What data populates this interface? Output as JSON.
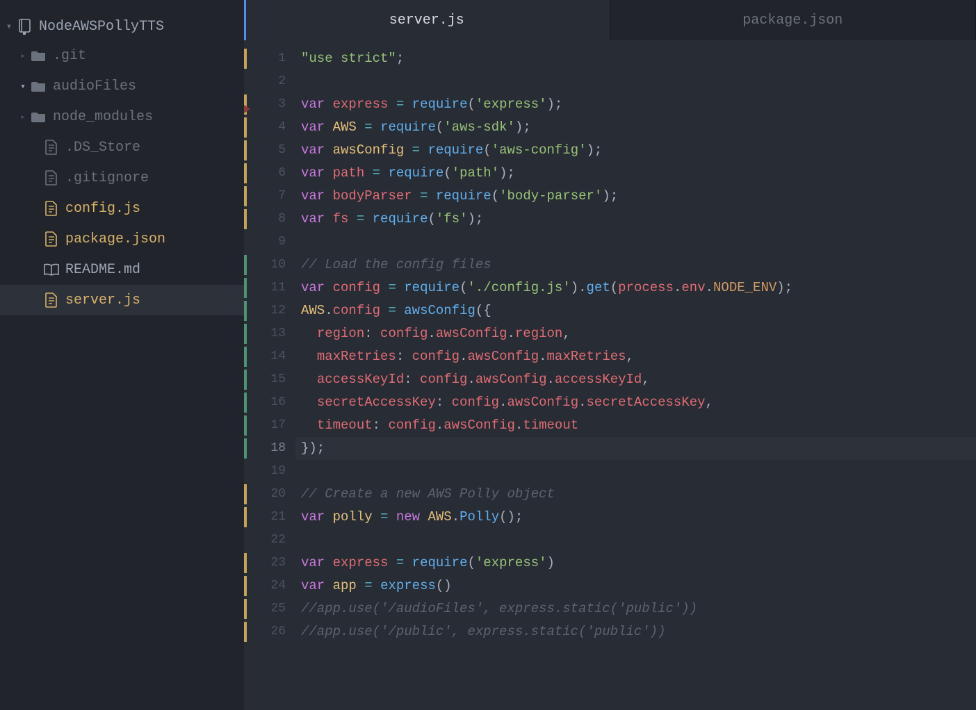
{
  "project": {
    "name": "NodeAWSPollyTTS"
  },
  "tree": [
    {
      "kind": "folder",
      "name": ".git",
      "open": false,
      "modified": false
    },
    {
      "kind": "folder",
      "name": "audioFiles",
      "open": true,
      "modified": false
    },
    {
      "kind": "folder",
      "name": "node_modules",
      "open": false,
      "modified": false
    },
    {
      "kind": "file",
      "name": ".DS_Store",
      "icon": "file",
      "modified": false,
      "indent": true
    },
    {
      "kind": "file",
      "name": ".gitignore",
      "icon": "file",
      "modified": false,
      "indent": true
    },
    {
      "kind": "file",
      "name": "config.js",
      "icon": "file",
      "modified": true,
      "indent": true
    },
    {
      "kind": "file",
      "name": "package.json",
      "icon": "file",
      "modified": true,
      "indent": true
    },
    {
      "kind": "file",
      "name": "README.md",
      "icon": "book",
      "modified": false,
      "indent": true,
      "light": true
    },
    {
      "kind": "file",
      "name": "server.js",
      "icon": "file",
      "modified": true,
      "indent": true,
      "selected": true
    }
  ],
  "tabs": [
    {
      "label": "server.js",
      "active": true
    },
    {
      "label": "package.json",
      "active": false
    }
  ],
  "gutterMarks": {
    "yellow": [
      1,
      3,
      4,
      5,
      6,
      7,
      8,
      20,
      21,
      23,
      24,
      25,
      26
    ],
    "green": [
      10,
      11,
      12,
      13,
      14,
      15,
      16,
      17,
      18
    ]
  },
  "currentLine": 18,
  "code": [
    {
      "n": 1,
      "t": [
        [
          "str",
          "\"use strict\""
        ],
        [
          "pun",
          ";"
        ]
      ]
    },
    {
      "n": 2,
      "t": []
    },
    {
      "n": 3,
      "t": [
        [
          "kw",
          "var"
        ],
        [
          "pun",
          " "
        ],
        [
          "nm2",
          "express"
        ],
        [
          "pun",
          " "
        ],
        [
          "op",
          "="
        ],
        [
          "pun",
          " "
        ],
        [
          "fn",
          "require"
        ],
        [
          "pun",
          "("
        ],
        [
          "str",
          "'express'"
        ],
        [
          "pun",
          ");"
        ]
      ]
    },
    {
      "n": 4,
      "t": [
        [
          "kw",
          "var"
        ],
        [
          "pun",
          " "
        ],
        [
          "nm1",
          "AWS"
        ],
        [
          "pun",
          " "
        ],
        [
          "op",
          "="
        ],
        [
          "pun",
          " "
        ],
        [
          "fn",
          "require"
        ],
        [
          "pun",
          "("
        ],
        [
          "str",
          "'aws-sdk'"
        ],
        [
          "pun",
          ");"
        ]
      ]
    },
    {
      "n": 5,
      "t": [
        [
          "kw",
          "var"
        ],
        [
          "pun",
          " "
        ],
        [
          "nm1",
          "awsConfig"
        ],
        [
          "pun",
          " "
        ],
        [
          "op",
          "="
        ],
        [
          "pun",
          " "
        ],
        [
          "fn",
          "require"
        ],
        [
          "pun",
          "("
        ],
        [
          "str",
          "'aws-config'"
        ],
        [
          "pun",
          ");"
        ]
      ]
    },
    {
      "n": 6,
      "t": [
        [
          "kw",
          "var"
        ],
        [
          "pun",
          " "
        ],
        [
          "nm2",
          "path"
        ],
        [
          "pun",
          " "
        ],
        [
          "op",
          "="
        ],
        [
          "pun",
          " "
        ],
        [
          "fn",
          "require"
        ],
        [
          "pun",
          "("
        ],
        [
          "str",
          "'path'"
        ],
        [
          "pun",
          ");"
        ]
      ]
    },
    {
      "n": 7,
      "t": [
        [
          "kw",
          "var"
        ],
        [
          "pun",
          " "
        ],
        [
          "nm2",
          "bodyParser"
        ],
        [
          "pun",
          " "
        ],
        [
          "op",
          "="
        ],
        [
          "pun",
          " "
        ],
        [
          "fn",
          "require"
        ],
        [
          "pun",
          "("
        ],
        [
          "str",
          "'body-parser'"
        ],
        [
          "pun",
          ");"
        ]
      ]
    },
    {
      "n": 8,
      "t": [
        [
          "kw",
          "var"
        ],
        [
          "pun",
          " "
        ],
        [
          "nm2",
          "fs"
        ],
        [
          "pun",
          " "
        ],
        [
          "op",
          "="
        ],
        [
          "pun",
          " "
        ],
        [
          "fn",
          "require"
        ],
        [
          "pun",
          "("
        ],
        [
          "str",
          "'fs'"
        ],
        [
          "pun",
          ");"
        ]
      ]
    },
    {
      "n": 9,
      "t": []
    },
    {
      "n": 10,
      "t": [
        [
          "cmt",
          "// Load the config files"
        ]
      ]
    },
    {
      "n": 11,
      "t": [
        [
          "kw",
          "var"
        ],
        [
          "pun",
          " "
        ],
        [
          "nm2",
          "config"
        ],
        [
          "pun",
          " "
        ],
        [
          "op",
          "="
        ],
        [
          "pun",
          " "
        ],
        [
          "fn",
          "require"
        ],
        [
          "pun",
          "("
        ],
        [
          "str",
          "'./config.js'"
        ],
        [
          "pun",
          ")."
        ],
        [
          "fn",
          "get"
        ],
        [
          "pun",
          "("
        ],
        [
          "nm2",
          "process"
        ],
        [
          "pun",
          "."
        ],
        [
          "nm2",
          "env"
        ],
        [
          "pun",
          "."
        ],
        [
          "cst",
          "NODE_ENV"
        ],
        [
          "pun",
          ");"
        ]
      ]
    },
    {
      "n": 12,
      "t": [
        [
          "nm1",
          "AWS"
        ],
        [
          "pun",
          "."
        ],
        [
          "nm2",
          "config"
        ],
        [
          "pun",
          " "
        ],
        [
          "op",
          "="
        ],
        [
          "pun",
          " "
        ],
        [
          "fn",
          "awsConfig"
        ],
        [
          "pun",
          "({"
        ]
      ]
    },
    {
      "n": 13,
      "t": [
        [
          "pun",
          "  "
        ],
        [
          "nm2",
          "region"
        ],
        [
          "pun",
          ": "
        ],
        [
          "nm2",
          "config"
        ],
        [
          "pun",
          "."
        ],
        [
          "nm2",
          "awsConfig"
        ],
        [
          "pun",
          "."
        ],
        [
          "nm2",
          "region"
        ],
        [
          "pun",
          ","
        ]
      ]
    },
    {
      "n": 14,
      "t": [
        [
          "pun",
          "  "
        ],
        [
          "nm2",
          "maxRetries"
        ],
        [
          "pun",
          ": "
        ],
        [
          "nm2",
          "config"
        ],
        [
          "pun",
          "."
        ],
        [
          "nm2",
          "awsConfig"
        ],
        [
          "pun",
          "."
        ],
        [
          "nm2",
          "maxRetries"
        ],
        [
          "pun",
          ","
        ]
      ]
    },
    {
      "n": 15,
      "t": [
        [
          "pun",
          "  "
        ],
        [
          "nm2",
          "accessKeyId"
        ],
        [
          "pun",
          ": "
        ],
        [
          "nm2",
          "config"
        ],
        [
          "pun",
          "."
        ],
        [
          "nm2",
          "awsConfig"
        ],
        [
          "pun",
          "."
        ],
        [
          "nm2",
          "accessKeyId"
        ],
        [
          "pun",
          ","
        ]
      ]
    },
    {
      "n": 16,
      "t": [
        [
          "pun",
          "  "
        ],
        [
          "nm2",
          "secretAccessKey"
        ],
        [
          "pun",
          ": "
        ],
        [
          "nm2",
          "config"
        ],
        [
          "pun",
          "."
        ],
        [
          "nm2",
          "awsConfig"
        ],
        [
          "pun",
          "."
        ],
        [
          "nm2",
          "secretAccessKey"
        ],
        [
          "pun",
          ","
        ]
      ]
    },
    {
      "n": 17,
      "t": [
        [
          "pun",
          "  "
        ],
        [
          "nm2",
          "timeout"
        ],
        [
          "pun",
          ": "
        ],
        [
          "nm2",
          "config"
        ],
        [
          "pun",
          "."
        ],
        [
          "nm2",
          "awsConfig"
        ],
        [
          "pun",
          "."
        ],
        [
          "nm2",
          "timeout"
        ]
      ]
    },
    {
      "n": 18,
      "t": [
        [
          "pun",
          "});"
        ]
      ]
    },
    {
      "n": 19,
      "t": []
    },
    {
      "n": 20,
      "t": [
        [
          "cmt",
          "// Create a new AWS Polly object"
        ]
      ]
    },
    {
      "n": 21,
      "t": [
        [
          "kw",
          "var"
        ],
        [
          "pun",
          " "
        ],
        [
          "nm1",
          "polly"
        ],
        [
          "pun",
          " "
        ],
        [
          "op",
          "="
        ],
        [
          "pun",
          " "
        ],
        [
          "kw",
          "new"
        ],
        [
          "pun",
          " "
        ],
        [
          "nm1",
          "AWS"
        ],
        [
          "pun",
          "."
        ],
        [
          "fn",
          "Polly"
        ],
        [
          "pun",
          "();"
        ]
      ]
    },
    {
      "n": 22,
      "t": []
    },
    {
      "n": 23,
      "t": [
        [
          "kw",
          "var"
        ],
        [
          "pun",
          " "
        ],
        [
          "nm2",
          "express"
        ],
        [
          "pun",
          " "
        ],
        [
          "op",
          "="
        ],
        [
          "pun",
          " "
        ],
        [
          "fn",
          "require"
        ],
        [
          "pun",
          "("
        ],
        [
          "str",
          "'express'"
        ],
        [
          "pun",
          ")"
        ]
      ]
    },
    {
      "n": 24,
      "t": [
        [
          "kw",
          "var"
        ],
        [
          "pun",
          " "
        ],
        [
          "nm1",
          "app"
        ],
        [
          "pun",
          " "
        ],
        [
          "op",
          "="
        ],
        [
          "pun",
          " "
        ],
        [
          "fn",
          "express"
        ],
        [
          "pun",
          "()"
        ]
      ]
    },
    {
      "n": 25,
      "t": [
        [
          "cmt",
          "//app.use('/audioFiles', express.static('public'))"
        ]
      ]
    },
    {
      "n": 26,
      "t": [
        [
          "cmt",
          "//app.use('/public', express.static('public'))"
        ]
      ]
    }
  ]
}
